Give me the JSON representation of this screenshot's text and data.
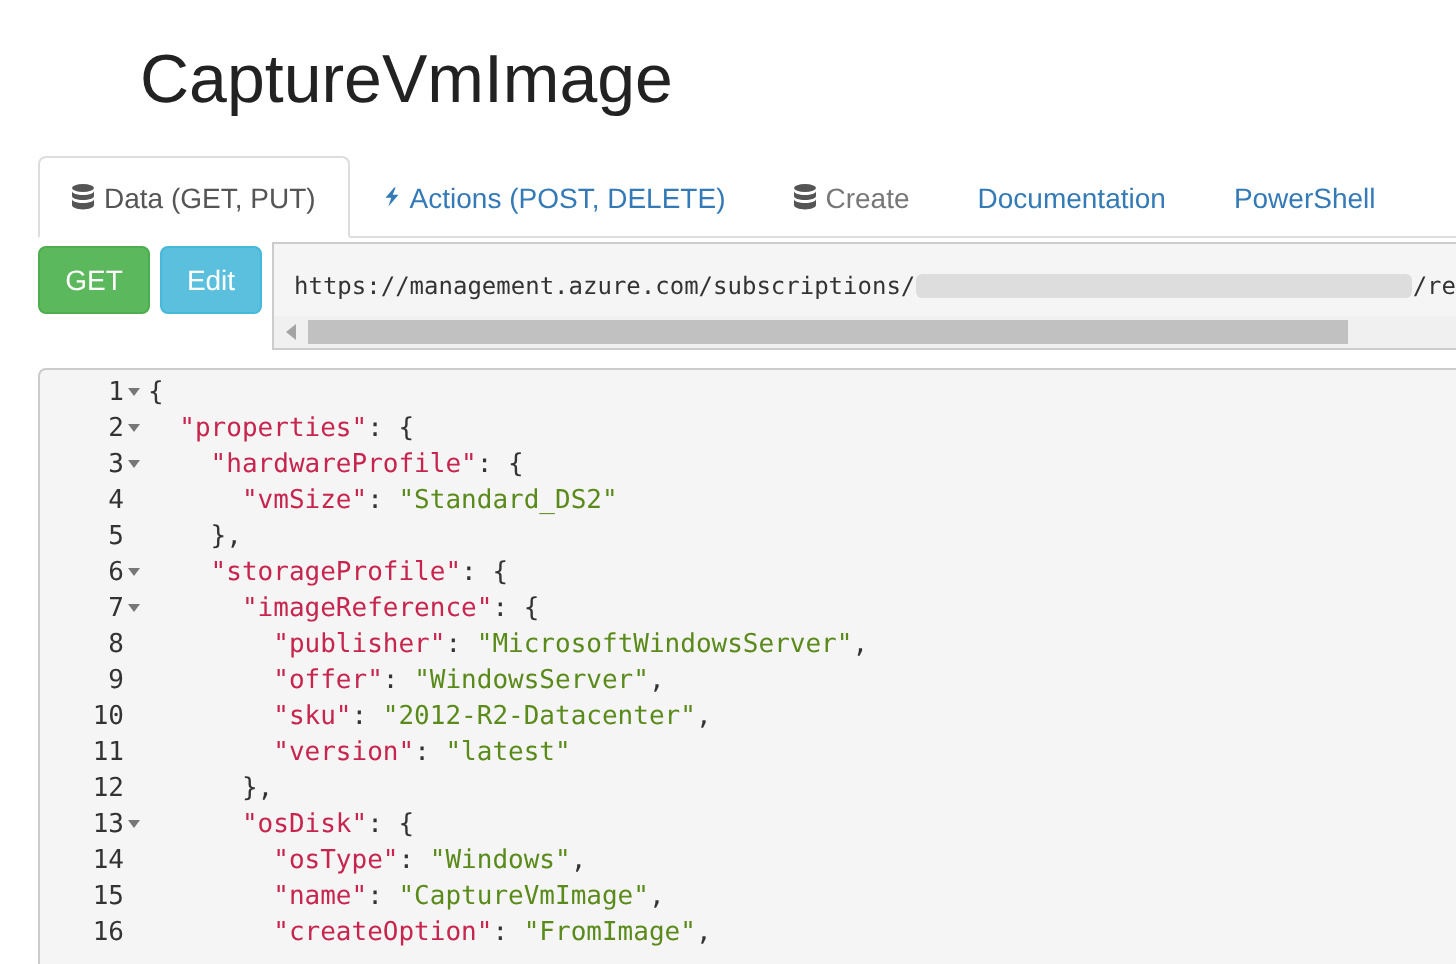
{
  "title": "CaptureVmImage",
  "tabs": [
    {
      "label": "Data (GET, PUT)",
      "kind": "resource",
      "selected": true,
      "disabled": false
    },
    {
      "label": "Actions (POST, DELETE)",
      "kind": "action",
      "selected": false,
      "disabled": false
    },
    {
      "label": "Create",
      "kind": "resource",
      "selected": false,
      "disabled": true
    },
    {
      "label": "Documentation",
      "kind": "link",
      "selected": false,
      "disabled": false
    },
    {
      "label": "PowerShell",
      "kind": "link",
      "selected": false,
      "disabled": false
    }
  ],
  "buttons": [
    {
      "label": "GET",
      "kind": "primary"
    },
    {
      "label": "Edit",
      "kind": "info"
    }
  ],
  "url": {
    "prefix": "https://management.azure.com/subscriptions/",
    "suffix": "/re"
  },
  "editor": {
    "lines": [
      {
        "number": "1",
        "fold": true,
        "tokens": [
          {
            "kind": "punct",
            "text": "{"
          }
        ]
      },
      {
        "number": "2",
        "fold": true,
        "tokens": [
          {
            "kind": "key",
            "text": "  \"properties\""
          },
          {
            "kind": "punct",
            "text": ": {"
          }
        ]
      },
      {
        "number": "3",
        "fold": true,
        "tokens": [
          {
            "kind": "key",
            "text": "    \"hardwareProfile\""
          },
          {
            "kind": "punct",
            "text": ": {"
          }
        ]
      },
      {
        "number": "4",
        "fold": false,
        "tokens": [
          {
            "kind": "key",
            "text": "      \"vmSize\""
          },
          {
            "kind": "punct",
            "text": ": "
          },
          {
            "kind": "string",
            "text": "\"Standard_DS2\""
          }
        ]
      },
      {
        "number": "5",
        "fold": false,
        "tokens": [
          {
            "kind": "punct",
            "text": "    },"
          }
        ]
      },
      {
        "number": "6",
        "fold": true,
        "tokens": [
          {
            "kind": "key",
            "text": "    \"storageProfile\""
          },
          {
            "kind": "punct",
            "text": ": {"
          }
        ]
      },
      {
        "number": "7",
        "fold": true,
        "tokens": [
          {
            "kind": "key",
            "text": "      \"imageReference\""
          },
          {
            "kind": "punct",
            "text": ": {"
          }
        ]
      },
      {
        "number": "8",
        "fold": false,
        "tokens": [
          {
            "kind": "key",
            "text": "        \"publisher\""
          },
          {
            "kind": "punct",
            "text": ": "
          },
          {
            "kind": "string",
            "text": "\"MicrosoftWindowsServer\""
          },
          {
            "kind": "punct",
            "text": ","
          }
        ]
      },
      {
        "number": "9",
        "fold": false,
        "tokens": [
          {
            "kind": "key",
            "text": "        \"offer\""
          },
          {
            "kind": "punct",
            "text": ": "
          },
          {
            "kind": "string",
            "text": "\"WindowsServer\""
          },
          {
            "kind": "punct",
            "text": ","
          }
        ]
      },
      {
        "number": "10",
        "fold": false,
        "tokens": [
          {
            "kind": "key",
            "text": "        \"sku\""
          },
          {
            "kind": "punct",
            "text": ": "
          },
          {
            "kind": "string",
            "text": "\"2012-R2-Datacenter\""
          },
          {
            "kind": "punct",
            "text": ","
          }
        ]
      },
      {
        "number": "11",
        "fold": false,
        "tokens": [
          {
            "kind": "key",
            "text": "        \"version\""
          },
          {
            "kind": "punct",
            "text": ": "
          },
          {
            "kind": "string",
            "text": "\"latest\""
          }
        ]
      },
      {
        "number": "12",
        "fold": false,
        "tokens": [
          {
            "kind": "punct",
            "text": "      },"
          }
        ]
      },
      {
        "number": "13",
        "fold": true,
        "tokens": [
          {
            "kind": "key",
            "text": "      \"osDisk\""
          },
          {
            "kind": "punct",
            "text": ": {"
          }
        ]
      },
      {
        "number": "14",
        "fold": false,
        "tokens": [
          {
            "kind": "key",
            "text": "        \"osType\""
          },
          {
            "kind": "punct",
            "text": ": "
          },
          {
            "kind": "string",
            "text": "\"Windows\""
          },
          {
            "kind": "punct",
            "text": ","
          }
        ]
      },
      {
        "number": "15",
        "fold": false,
        "tokens": [
          {
            "kind": "key",
            "text": "        \"name\""
          },
          {
            "kind": "punct",
            "text": ": "
          },
          {
            "kind": "string",
            "text": "\"CaptureVmImage\""
          },
          {
            "kind": "punct",
            "text": ","
          }
        ]
      },
      {
        "number": "16",
        "fold": false,
        "tokens": [
          {
            "kind": "key",
            "text": "        \"createOption\""
          },
          {
            "kind": "punct",
            "text": ": "
          },
          {
            "kind": "string",
            "text": "\"FromImage\""
          },
          {
            "kind": "punct",
            "text": ","
          }
        ]
      }
    ]
  }
}
